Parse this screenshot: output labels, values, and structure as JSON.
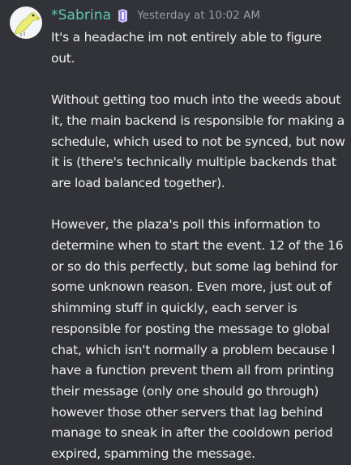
{
  "author": {
    "username": "*Sabrina",
    "username_color": "#5fc9b3",
    "avatar_icon": "yellow-duck-avatar",
    "role_icon": "role-icon"
  },
  "timestamp": "Yesterday at 10:02 AM",
  "message": {
    "paragraphs": [
      "It's a headache im not entirely able to figure out.",
      "Without getting too much into the weeds about it, the main backend is responsible for making a schedule, which used to not be synced, but now it is (there's technically multiple backends that are load balanced together).",
      "However, the plaza's poll this information to determine when to start the event. 12 of the 16 or so do this perfectly, but some lag behind for some unknown reason. Even more, just out of shimming stuff in quickly, each server is responsible for posting the message to global chat, which isn't normally a problem because I have a function prevent them all from printing their message (only one should go through) however those other servers that lag behind manage to sneak in after the cooldown period expired, spamming the message."
    ]
  },
  "colors": {
    "background": "#313338",
    "text": "#eeeff2",
    "timestamp": "#9a9ca4"
  }
}
